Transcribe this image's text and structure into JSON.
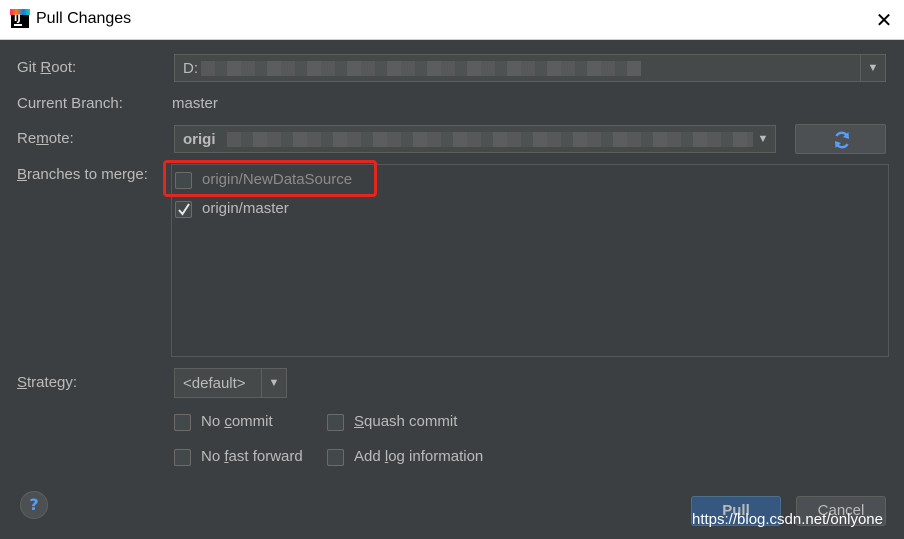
{
  "window": {
    "title": "Pull Changes",
    "close_icon": "close-icon"
  },
  "form": {
    "git_root": {
      "label_pre": "Git ",
      "label_mn": "R",
      "label_post": "oot:",
      "value": "D:"
    },
    "current_branch": {
      "label": "Current Branch:",
      "value": "master"
    },
    "remote": {
      "label_pre": "Re",
      "label_mn": "m",
      "label_post": "ote:",
      "value": "origi"
    },
    "branches": {
      "label_pre": "",
      "label_mn": "B",
      "label_post": "ranches to merge:",
      "items": [
        {
          "label": "origin/NewDataSource",
          "checked": false
        },
        {
          "label": "origin/master",
          "checked": true
        }
      ]
    },
    "strategy": {
      "label_pre": "",
      "label_mn": "S",
      "label_post": "trategy:",
      "value": "<default>"
    },
    "options": {
      "no_commit": {
        "pre": "No ",
        "mn": "c",
        "post": "ommit",
        "checked": false
      },
      "squash_commit": {
        "pre": "",
        "mn": "S",
        "post": "quash commit",
        "checked": false
      },
      "no_fast_forward": {
        "pre": "No ",
        "mn": "f",
        "post": "ast forward",
        "checked": false
      },
      "add_log": {
        "pre": "Add ",
        "mn": "l",
        "post": "og information",
        "checked": false
      }
    }
  },
  "buttons": {
    "help": "?",
    "pull": "Pull",
    "cancel": "Cancel"
  },
  "watermark": "https://blog.csdn.net/onlyone",
  "colors": {
    "accent": "#589df6",
    "highlight": "#e3261e",
    "default_button": "#365880"
  }
}
